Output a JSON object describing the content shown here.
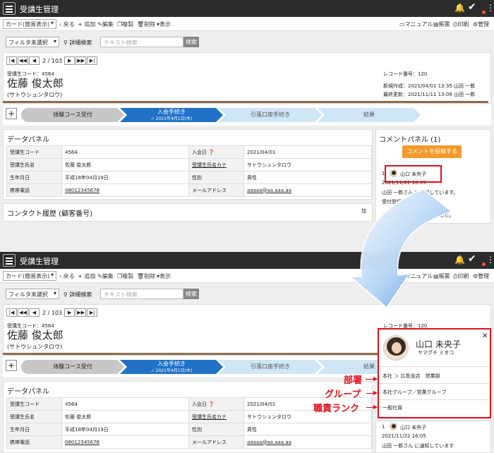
{
  "app": {
    "title": "受講生管理"
  },
  "toolbar": {
    "view_select": "カード(簡易表示)",
    "back": "戻る",
    "add": "追加",
    "edit": "編集",
    "copy": "複製",
    "delete": "削除",
    "show": "表示",
    "manual": "マニュアル",
    "report": "帳票",
    "print": "印刷",
    "admin": "管理"
  },
  "filter": {
    "select": "フィルタ未選択",
    "advanced": "詳細検索",
    "placeholder": "テキスト検索",
    "search_button": "検索"
  },
  "pager": {
    "text": "2 / 103"
  },
  "record": {
    "code": "受講生コード：4564",
    "name": "佐藤 俊太郎",
    "kana": "(サトウシュンタロウ)",
    "number": "レコード番号：120",
    "created": "新規作成：2021/04/01 13:35 山田 一郎",
    "updated": "最終更新：2021/11/11 13:09 山田 一郎"
  },
  "steps": [
    {
      "label": "体験コース受付"
    },
    {
      "label": "入会手続き",
      "date": "✓ 2021年4月1日(木)"
    },
    {
      "label": "引落口座手続き"
    },
    {
      "label": "結果"
    }
  ],
  "data_panel": {
    "title": "データパネル",
    "rows": [
      [
        "受講生コード",
        "4564",
        "入会日 ❓",
        "2021/04/01"
      ],
      [
        "受講生氏名",
        "佐藤 俊太郎",
        "受講生氏名カナ",
        "サトウシュンタロウ"
      ],
      [
        "生年月日",
        "平成18年04月19日",
        "性別",
        "男性"
      ],
      [
        "携帯電話",
        "08012345678",
        "メールアドレス",
        "aaaaa@aa.aaa.aa"
      ]
    ]
  },
  "contact": {
    "title": "コンタクト履歴 (顧客番号)",
    "cut": "加"
  },
  "comment": {
    "title": "コメントパネル (1)",
    "post_button": "コメントを投稿する",
    "number": "1",
    "author": "山口 未央子",
    "date": "2021/11/22 16:05",
    "line1": "山田 一郎さん に通知しています。",
    "line1_cut": "山田 一郎さん に通知しています",
    "line2": "受付登録を完了しました。",
    "line3": "山田 一郎さん が閲覧しました。"
  },
  "popup": {
    "name": "山口 未央子",
    "kana": "ヤマグチ ミオコ",
    "dept": "本社 ＞ 広島支店　営業部",
    "group": "本社グループ／営業グループ",
    "rank": "一般社員"
  },
  "callouts": {
    "dept": "部署",
    "group": "グループ",
    "rank": "職責ランク"
  },
  "colors": {
    "titlebar": "#2b2b2b",
    "accent": "#1f72c8",
    "post_button": "#f39a2b",
    "highlight": "#e0101a"
  }
}
